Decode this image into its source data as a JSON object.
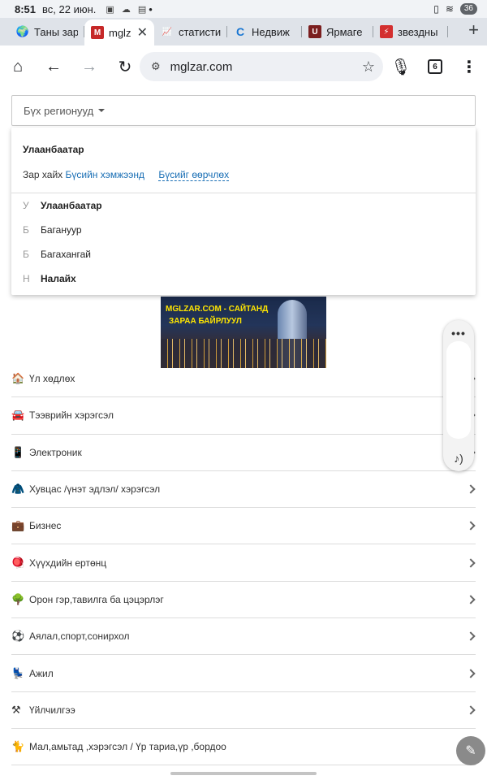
{
  "status_bar": {
    "time": "8:51",
    "date": "вс, 22 июн.",
    "dot": "•",
    "battery": "36"
  },
  "tabs": [
    {
      "title": "Таны зар",
      "favicon": "globe-icon",
      "active": false
    },
    {
      "title": "mglzar",
      "favicon": "m-logo-icon",
      "active": true
    },
    {
      "title": "статисти",
      "favicon": "chart-icon",
      "active": false
    },
    {
      "title": "Недвиж",
      "favicon": "c-logo-icon",
      "active": false
    },
    {
      "title": "Ярмаге",
      "favicon": "u-logo-icon",
      "active": false
    },
    {
      "title": "звездны",
      "favicon": "bolt-icon",
      "active": false
    }
  ],
  "toolbar": {
    "url": "mglzar.com",
    "tab_count": "6"
  },
  "region_select": {
    "label": "Бүх регионууд"
  },
  "dropdown": {
    "title": "Улаанбаатар",
    "search_prefix": "Зар хайх",
    "search_link": "Бүсийн хэмжээнд",
    "change_link": "Бүсийг өөрчлөх",
    "items": [
      {
        "letter": "У",
        "name": "Улаанбаатар",
        "bold": true
      },
      {
        "letter": "Б",
        "name": "Багануур",
        "bold": false
      },
      {
        "letter": "Б",
        "name": "Багахангай",
        "bold": false
      },
      {
        "letter": "Н",
        "name": "Налайх",
        "bold": true
      }
    ]
  },
  "banner": {
    "line1": "MGLZAR.COM - САЙТАНД",
    "line2": "ЗАРАА БАЙРЛУУЛ"
  },
  "categories": [
    {
      "icon": "house-icon",
      "label": "Үл хөдлөх"
    },
    {
      "icon": "car-icon",
      "label": "Тээврийн хэрэгсэл"
    },
    {
      "icon": "phone-icon",
      "label": "Электроник"
    },
    {
      "icon": "clothing-icon",
      "label": "Хувцас /үнэт эдлэл/ хэрэгсэл"
    },
    {
      "icon": "briefcase-icon",
      "label": "Бизнес"
    },
    {
      "icon": "toy-icon",
      "label": "Хүүхдийн ертөнц"
    },
    {
      "icon": "tree-icon",
      "label": "Орон гэр,тавилга ба цэцэрлэг"
    },
    {
      "icon": "soccer-ball-icon",
      "label": "Аялал,спорт,сонирхол"
    },
    {
      "icon": "work-icon",
      "label": "Ажил"
    },
    {
      "icon": "tools-icon",
      "label": "Үйлчилгээ"
    },
    {
      "icon": "cat-icon",
      "label": "Мал,амьтад ,хэрэгсэл / Үр тариа,үр ,бордоо"
    }
  ]
}
